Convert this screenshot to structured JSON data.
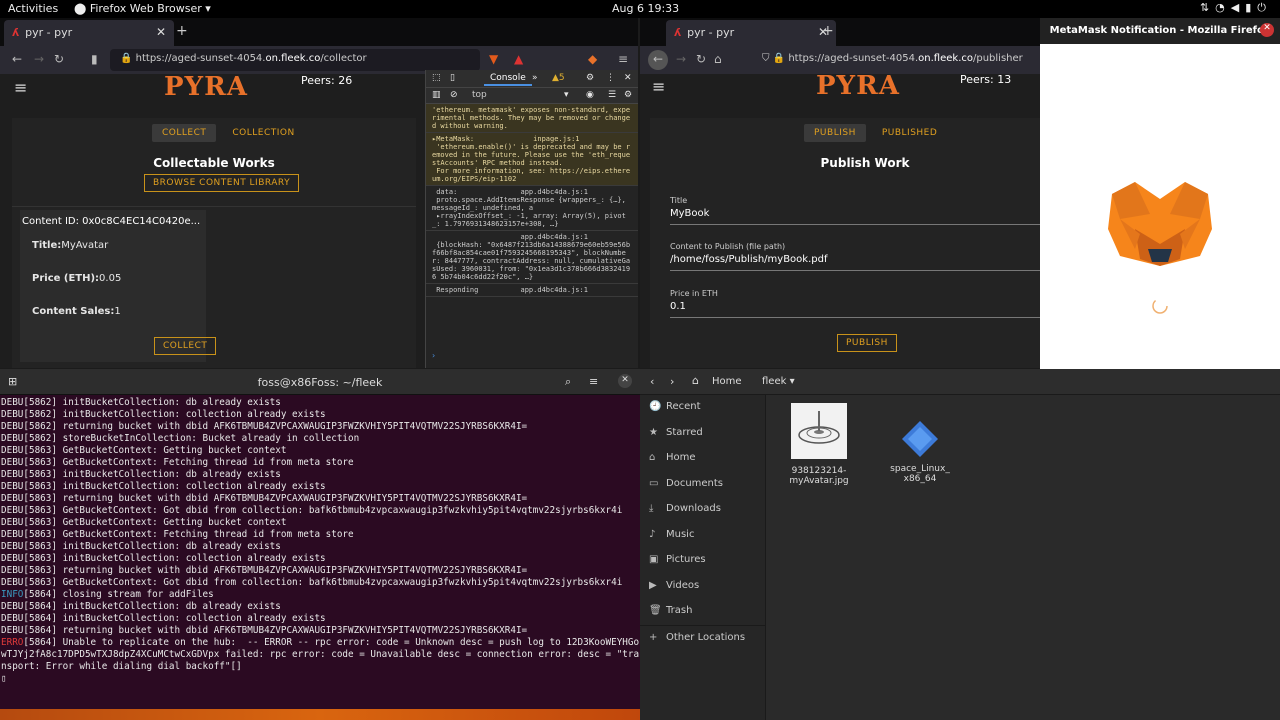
{
  "topbar": {
    "activities": "Activities",
    "app": "Firefox Web Browser ▾",
    "clock": "Aug 6  19:33"
  },
  "left_browser": {
    "tab_title": "pyr - pyr",
    "url_prefix": "https://aged-sunset-4054.",
    "url_domain": "on.fleek.co",
    "url_path": "/collector",
    "logo": "PYRA",
    "peers": "Peers: 26",
    "tabs": [
      "COLLECT",
      "COLLECTION"
    ],
    "heading": "Collectable Works",
    "browse_btn": "BROWSE CONTENT LIBRARY",
    "card": {
      "content_id": "Content ID: 0x0c8C4EC14C0420e...",
      "title_label": "Title:",
      "title_value": "MyAvatar",
      "price_label": "Price (ETH):",
      "price_value": "0.05",
      "sales_label": "Content Sales:",
      "sales_value": "1",
      "collect_btn": "COLLECT"
    },
    "devtools": {
      "tab": "Console",
      "warn_count": "5",
      "filter": "top",
      "lines": [
        {
          "cls": "warn",
          "text": "'ethereum. metamask' exposes non-standard, experimental methods. They may be removed or changed without warning."
        },
        {
          "cls": "warn",
          "text": "▸MetaMask:              inpage.js:1\n 'ethereum.enable()' is deprecated and may be removed in the future. Please use the 'eth_requestAccounts' RPC method instead.\n For more information, see: https://eips.ethereum.org/EIPS/eip-1102"
        },
        {
          "cls": "",
          "text": " data:               app.d4bc4da.js:1\n proto.space.AddItemsResponse {wrappers_: {…}, messageId_: undefined, a\n ▸rrayIndexOffset_: -1, array: Array(5), pivot_: 1.7976931348623157e+308, …}"
        },
        {
          "cls": "",
          "text": "                     app.d4bc4da.js:1\n {blockHash: \"0x6487f213db6a14388679e60eb59e56bf66bf8ac854cae01f7593245668195343\", blockNumber: 8447777, contractAddress: null, cumulativeGasUsed: 3960031, from: \"0x1ea3d1c378b666d38324196 5b74b04c6dd22f20c\", …}"
        },
        {
          "cls": "",
          "text": " Responding          app.d4bc4da.js:1"
        }
      ]
    }
  },
  "right_browser": {
    "tab_title": "pyr - pyr",
    "url_prefix": "https://aged-sunset-4054.",
    "url_domain": "on.fleek.co",
    "url_path": "/publisher",
    "logo": "PYRA",
    "peers": "Peers: 13",
    "tabs": [
      "PUBLISH",
      "PUBLISHED"
    ],
    "heading": "Publish Work",
    "fields": [
      {
        "label": "Title",
        "value": "MyBook"
      },
      {
        "label": "Content to Publish (file path)",
        "value": "/home/foss/Publish/myBook.pdf"
      },
      {
        "label": "Price in ETH",
        "value": "0.1"
      }
    ],
    "publish_btn": "PUBLISH"
  },
  "metamask": {
    "title": "MetaMask Notification - Mozilla Firefox"
  },
  "terminal": {
    "title": "foss@x86Foss: ~/fleek",
    "lines": [
      {
        "lv": "DEBU",
        "t": "[5862] initBucketCollection: db already exists"
      },
      {
        "lv": "DEBU",
        "t": "[5862] initBucketCollection: collection already exists"
      },
      {
        "lv": "DEBU",
        "t": "[5862] returning bucket with dbid AFK6TBMUB4ZVPCAXWAUGIP3FWZKVHIY5PIT4VQTMV22SJYRBS6KXR4I="
      },
      {
        "lv": "DEBU",
        "t": "[5862] storeBucketInCollection: Bucket already in collection"
      },
      {
        "lv": "DEBU",
        "t": "[5863] GetBucketContext: Getting bucket context"
      },
      {
        "lv": "DEBU",
        "t": "[5863] GetBucketContext: Fetching thread id from meta store"
      },
      {
        "lv": "DEBU",
        "t": "[5863] initBucketCollection: db already exists"
      },
      {
        "lv": "DEBU",
        "t": "[5863] initBucketCollection: collection already exists"
      },
      {
        "lv": "DEBU",
        "t": "[5863] returning bucket with dbid AFK6TBMUB4ZVPCAXWAUGIP3FWZKVHIY5PIT4VQTMV22SJYRBS6KXR4I="
      },
      {
        "lv": "DEBU",
        "t": "[5863] GetBucketContext: Got dbid from collection: bafk6tbmub4zvpcaxwaugip3fwzkvhiy5pit4vqtmv22sjyrbs6kxr4i"
      },
      {
        "lv": "DEBU",
        "t": "[5863] GetBucketContext: Getting bucket context"
      },
      {
        "lv": "DEBU",
        "t": "[5863] GetBucketContext: Fetching thread id from meta store"
      },
      {
        "lv": "DEBU",
        "t": "[5863] initBucketCollection: db already exists"
      },
      {
        "lv": "DEBU",
        "t": "[5863] initBucketCollection: collection already exists"
      },
      {
        "lv": "DEBU",
        "t": "[5863] returning bucket with dbid AFK6TBMUB4ZVPCAXWAUGIP3FWZKVHIY5PIT4VQTMV22SJYRBS6KXR4I="
      },
      {
        "lv": "DEBU",
        "t": "[5863] GetBucketContext: Got dbid from collection: bafk6tbmub4zvpcaxwaugip3fwzkvhiy5pit4vqtmv22sjyrbs6kxr4i"
      },
      {
        "lv": "INFO",
        "t": "[5864] closing stream for addFiles"
      },
      {
        "lv": "DEBU",
        "t": "[5864] initBucketCollection: db already exists"
      },
      {
        "lv": "DEBU",
        "t": "[5864] initBucketCollection: collection already exists"
      },
      {
        "lv": "DEBU",
        "t": "[5864] returning bucket with dbid AFK6TBMUB4ZVPCAXWAUGIP3FWZKVHIY5PIT4VQTMV22SJYRBS6KXR4I="
      },
      {
        "lv": "ERRO",
        "t": "[5864] Unable to replicate on the hub:  -- ERROR -- rpc error: code = Unknown desc = push log to 12D3KooWEYHGowTJYj2fA8c17DPD5wTXJ8dpZ4XCuMCtwCxGDVpx failed: rpc error: code = Unavailable desc = connection error: desc = \"transport: Error while dialing dial backoff\"[]"
      }
    ]
  },
  "files": {
    "breadcrumb": [
      "Home",
      "fleek ▾"
    ],
    "sidebar": [
      {
        "icon": "🕘",
        "label": "Recent"
      },
      {
        "icon": "★",
        "label": "Starred"
      },
      {
        "icon": "⌂",
        "label": "Home"
      },
      {
        "icon": "▭",
        "label": "Documents"
      },
      {
        "icon": "⤓",
        "label": "Downloads"
      },
      {
        "icon": "♪",
        "label": "Music"
      },
      {
        "icon": "▣",
        "label": "Pictures"
      },
      {
        "icon": "▶",
        "label": "Videos"
      },
      {
        "icon": "🗑",
        "label": "Trash"
      },
      {
        "icon": "+",
        "label": "Other Locations"
      }
    ],
    "items": [
      {
        "name": "938123214-\nmyAvatar.jpg"
      },
      {
        "name": "space_Linux_\nx86_64"
      }
    ]
  }
}
